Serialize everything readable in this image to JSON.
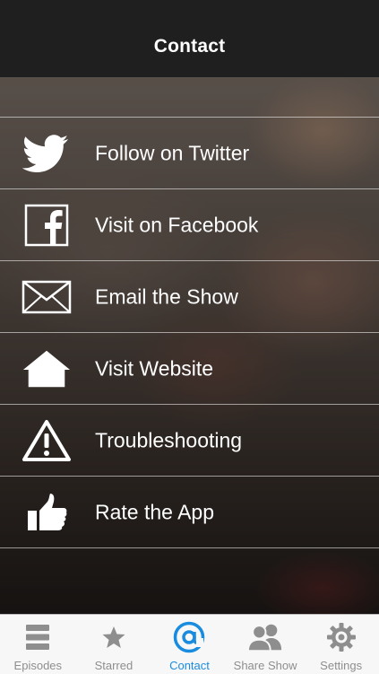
{
  "nav": {
    "title": "Contact"
  },
  "menu": {
    "items": [
      {
        "label": "Follow on Twitter",
        "icon": "twitter-bird-icon"
      },
      {
        "label": "Visit on Facebook",
        "icon": "facebook-icon"
      },
      {
        "label": "Email the Show",
        "icon": "envelope-icon"
      },
      {
        "label": "Visit Website",
        "icon": "home-icon"
      },
      {
        "label": "Troubleshooting",
        "icon": "warning-icon"
      },
      {
        "label": "Rate the App",
        "icon": "thumbs-up-icon"
      }
    ]
  },
  "tabs": {
    "items": [
      {
        "label": "Episodes",
        "icon": "list-icon"
      },
      {
        "label": "Starred",
        "icon": "star-icon"
      },
      {
        "label": "Contact",
        "icon": "at-sign-icon",
        "active": true
      },
      {
        "label": "Share Show",
        "icon": "people-icon"
      },
      {
        "label": "Settings",
        "icon": "gear-icon"
      }
    ]
  },
  "colors": {
    "nav_background": "#1f1f1f",
    "tab_active": "#1a8ce0",
    "tab_inactive": "#8e8e8e",
    "tab_bar_background": "#f7f7f7"
  }
}
